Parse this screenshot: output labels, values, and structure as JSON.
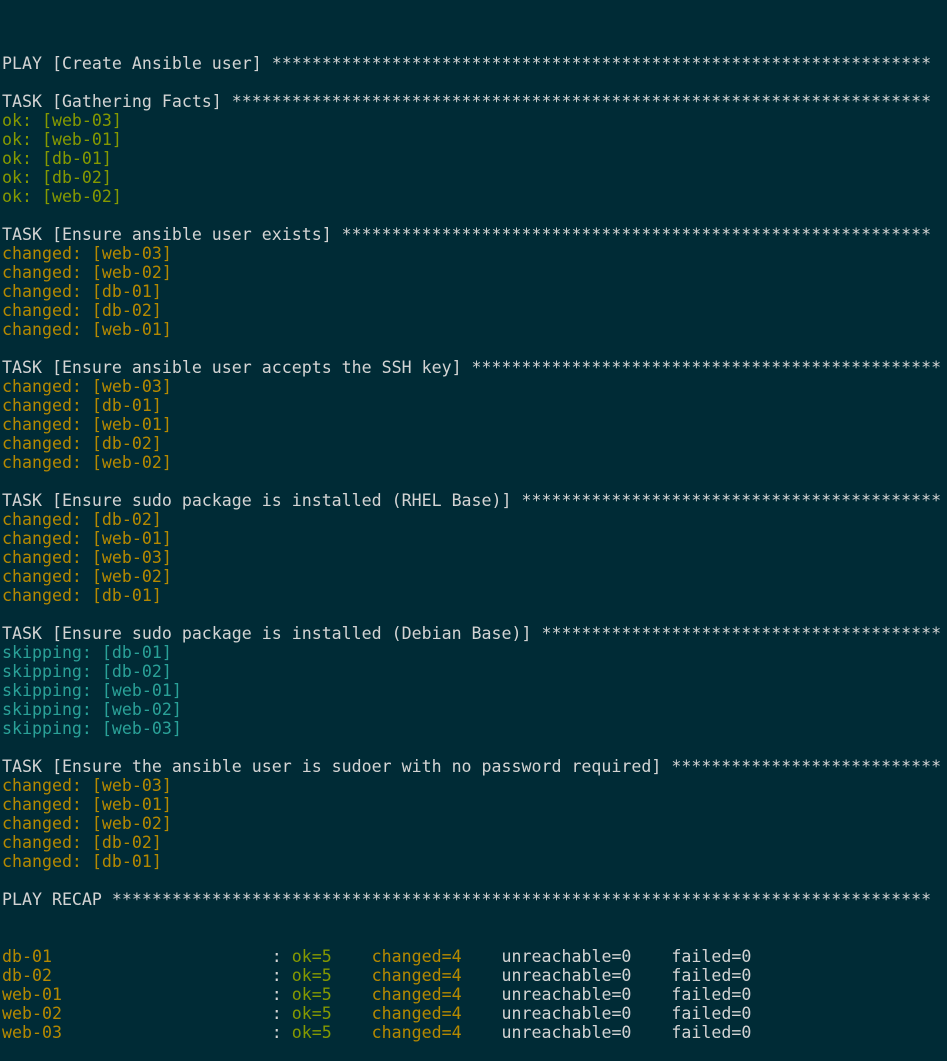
{
  "colors": {
    "background": "#002b36",
    "text": "#d4d4d4",
    "ok": "#859900",
    "changed": "#b58900",
    "skipping": "#2aa198"
  },
  "lines": [
    {
      "cls": "hdr",
      "text": "PLAY [Create Ansible user] ******************************************************************"
    },
    {
      "cls": "blank",
      "text": ""
    },
    {
      "cls": "hdr",
      "text": "TASK [Gathering Facts] **********************************************************************"
    },
    {
      "cls": "ok",
      "text": "ok: [web-03]"
    },
    {
      "cls": "ok",
      "text": "ok: [web-01]"
    },
    {
      "cls": "ok",
      "text": "ok: [db-01]"
    },
    {
      "cls": "ok",
      "text": "ok: [db-02]"
    },
    {
      "cls": "ok",
      "text": "ok: [web-02]"
    },
    {
      "cls": "blank",
      "text": ""
    },
    {
      "cls": "hdr",
      "text": "TASK [Ensure ansible user exists] ***********************************************************"
    },
    {
      "cls": "changed",
      "text": "changed: [web-03]"
    },
    {
      "cls": "changed",
      "text": "changed: [web-02]"
    },
    {
      "cls": "changed",
      "text": "changed: [db-01]"
    },
    {
      "cls": "changed",
      "text": "changed: [db-02]"
    },
    {
      "cls": "changed",
      "text": "changed: [web-01]"
    },
    {
      "cls": "blank",
      "text": ""
    },
    {
      "cls": "hdr",
      "text": "TASK [Ensure ansible user accepts the SSH key] ***********************************************"
    },
    {
      "cls": "changed",
      "text": "changed: [web-03]"
    },
    {
      "cls": "changed",
      "text": "changed: [db-01]"
    },
    {
      "cls": "changed",
      "text": "changed: [web-01]"
    },
    {
      "cls": "changed",
      "text": "changed: [db-02]"
    },
    {
      "cls": "changed",
      "text": "changed: [web-02]"
    },
    {
      "cls": "blank",
      "text": ""
    },
    {
      "cls": "hdr",
      "text": "TASK [Ensure sudo package is installed (RHEL Base)] ******************************************"
    },
    {
      "cls": "changed",
      "text": "changed: [db-02]"
    },
    {
      "cls": "changed",
      "text": "changed: [web-01]"
    },
    {
      "cls": "changed",
      "text": "changed: [web-03]"
    },
    {
      "cls": "changed",
      "text": "changed: [web-02]"
    },
    {
      "cls": "changed",
      "text": "changed: [db-01]"
    },
    {
      "cls": "blank",
      "text": ""
    },
    {
      "cls": "hdr",
      "text": "TASK [Ensure sudo package is installed (Debian Base)] ****************************************"
    },
    {
      "cls": "skipping",
      "text": "skipping: [db-01]"
    },
    {
      "cls": "skipping",
      "text": "skipping: [db-02]"
    },
    {
      "cls": "skipping",
      "text": "skipping: [web-01]"
    },
    {
      "cls": "skipping",
      "text": "skipping: [web-02]"
    },
    {
      "cls": "skipping",
      "text": "skipping: [web-03]"
    },
    {
      "cls": "blank",
      "text": ""
    },
    {
      "cls": "hdr",
      "text": "TASK [Ensure the ansible user is sudoer with no password required] ***************************"
    },
    {
      "cls": "changed",
      "text": "changed: [web-03]"
    },
    {
      "cls": "changed",
      "text": "changed: [web-01]"
    },
    {
      "cls": "changed",
      "text": "changed: [web-02]"
    },
    {
      "cls": "changed",
      "text": "changed: [db-02]"
    },
    {
      "cls": "changed",
      "text": "changed: [db-01]"
    },
    {
      "cls": "blank",
      "text": ""
    },
    {
      "cls": "hdr",
      "text": "PLAY RECAP **********************************************************************************"
    }
  ],
  "recap": [
    {
      "host": "db-01",
      "ok": "ok=5",
      "changed": "changed=4",
      "unreachable": "unreachable=0",
      "failed": "failed=0"
    },
    {
      "host": "db-02",
      "ok": "ok=5",
      "changed": "changed=4",
      "unreachable": "unreachable=0",
      "failed": "failed=0"
    },
    {
      "host": "web-01",
      "ok": "ok=5",
      "changed": "changed=4",
      "unreachable": "unreachable=0",
      "failed": "failed=0"
    },
    {
      "host": "web-02",
      "ok": "ok=5",
      "changed": "changed=4",
      "unreachable": "unreachable=0",
      "failed": "failed=0"
    },
    {
      "host": "web-03",
      "ok": "ok=5",
      "changed": "changed=4",
      "unreachable": "unreachable=0",
      "failed": "failed=0"
    }
  ]
}
